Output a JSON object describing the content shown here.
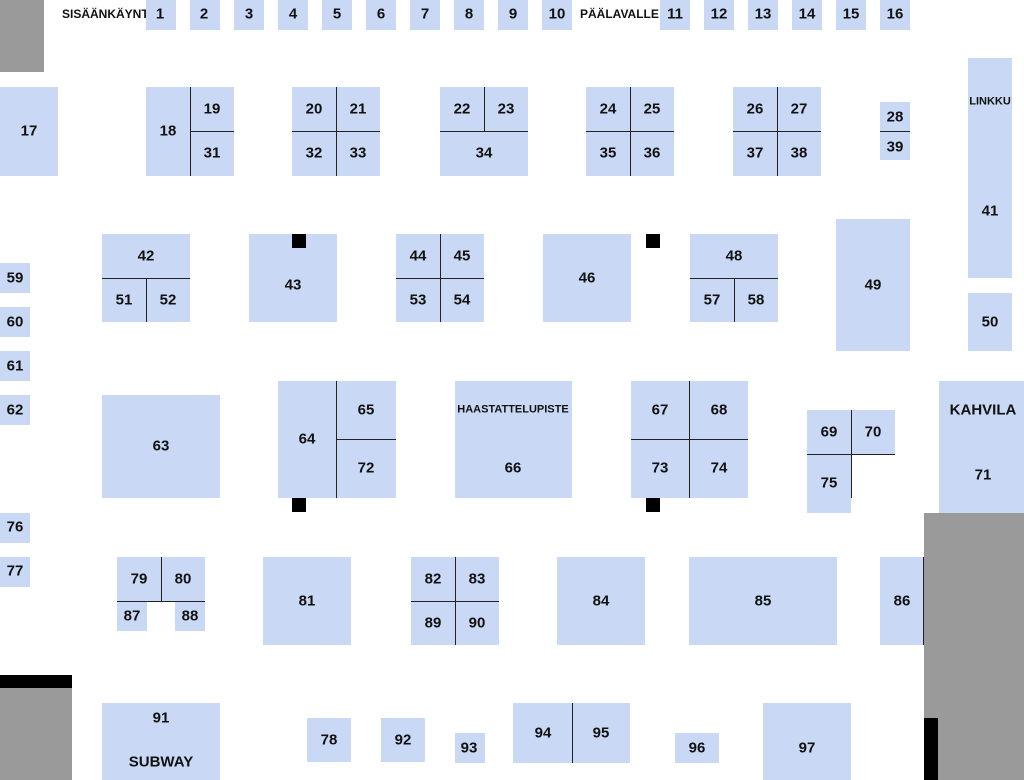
{
  "labels": {
    "entrance": "SISÄÄNKÄYNTI",
    "main_stage": "PÄÄLAVALLE",
    "link": "LINKKU",
    "interview": "HAASTATTELUPISTE",
    "cafe": "KAHVILA",
    "subway": "SUBWAY"
  },
  "booths": [
    "1",
    "2",
    "3",
    "4",
    "5",
    "6",
    "7",
    "8",
    "9",
    "10",
    "11",
    "12",
    "13",
    "14",
    "15",
    "16",
    "17",
    "18",
    "19",
    "20",
    "21",
    "22",
    "23",
    "24",
    "25",
    "26",
    "27",
    "28",
    "31",
    "32",
    "33",
    "34",
    "35",
    "36",
    "37",
    "38",
    "39",
    "41",
    "42",
    "43",
    "44",
    "45",
    "46",
    "48",
    "49",
    "50",
    "51",
    "52",
    "53",
    "54",
    "57",
    "58",
    "59",
    "60",
    "61",
    "62",
    "63",
    "64",
    "65",
    "66",
    "67",
    "68",
    "69",
    "70",
    "71",
    "72",
    "73",
    "74",
    "75",
    "76",
    "77",
    "78",
    "79",
    "80",
    "81",
    "82",
    "83",
    "84",
    "85",
    "86",
    "87",
    "88",
    "89",
    "90",
    "91",
    "92",
    "93",
    "94",
    "95",
    "96",
    "97"
  ],
  "colors": {
    "booth": "#c9d9f5",
    "wall": "#9a9a9a",
    "pillar": "#000000",
    "divider": "#222222"
  }
}
